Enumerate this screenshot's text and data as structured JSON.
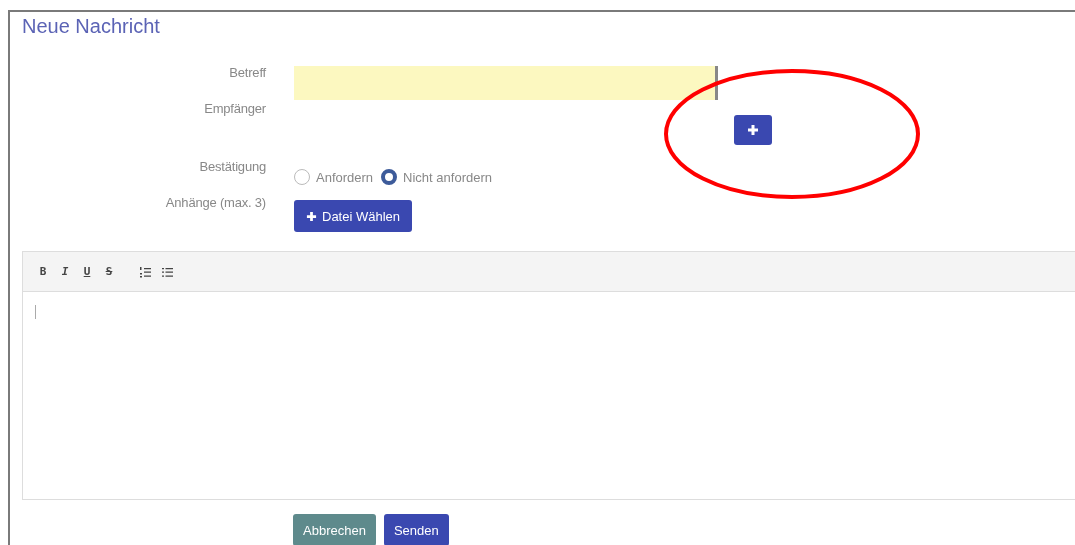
{
  "title": "Neue Nachricht",
  "fields": [
    {
      "kind": "text",
      "label": "Betreff"
    },
    {
      "kind": "add",
      "label": "Empfänger"
    },
    {
      "kind": "radio",
      "label": "Bestätigung",
      "options": [
        {
          "label": "Anfordern",
          "selected": false
        },
        {
          "label": "Nicht anfordern",
          "selected": true
        }
      ]
    },
    {
      "kind": "file",
      "label": "Anhänge (max. 3)",
      "button": "Datei Wählen"
    }
  ],
  "editor": {
    "toolbar": [
      {
        "kind": "bold",
        "label": "B"
      },
      {
        "kind": "italic",
        "label": "I"
      },
      {
        "kind": "underline",
        "label": "U"
      },
      {
        "kind": "strike",
        "label": "S"
      },
      {
        "kind": "ordered-list"
      },
      {
        "kind": "bullet-list"
      }
    ]
  },
  "buttons": [
    {
      "kind": "secondary",
      "label": "Abbrechen"
    },
    {
      "kind": "primary",
      "label": "Senden"
    }
  ]
}
